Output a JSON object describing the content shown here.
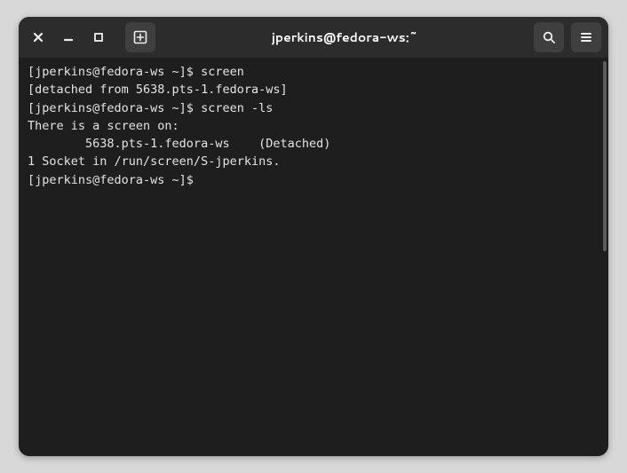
{
  "titlebar": {
    "title": "jperkins@fedora-ws:~"
  },
  "terminal": {
    "lines": [
      {
        "prompt": "[jperkins@fedora-ws ~]$ ",
        "cmd": "screen"
      },
      {
        "text": "[detached from 5638.pts-1.fedora-ws]"
      },
      {
        "prompt": "[jperkins@fedora-ws ~]$ ",
        "cmd": "screen -ls"
      },
      {
        "text": "There is a screen on:"
      },
      {
        "text": "        5638.pts-1.fedora-ws    (Detached)"
      },
      {
        "text": "1 Socket in /run/screen/S-jperkins."
      },
      {
        "prompt": "[jperkins@fedora-ws ~]$ ",
        "cmd": ""
      }
    ]
  }
}
